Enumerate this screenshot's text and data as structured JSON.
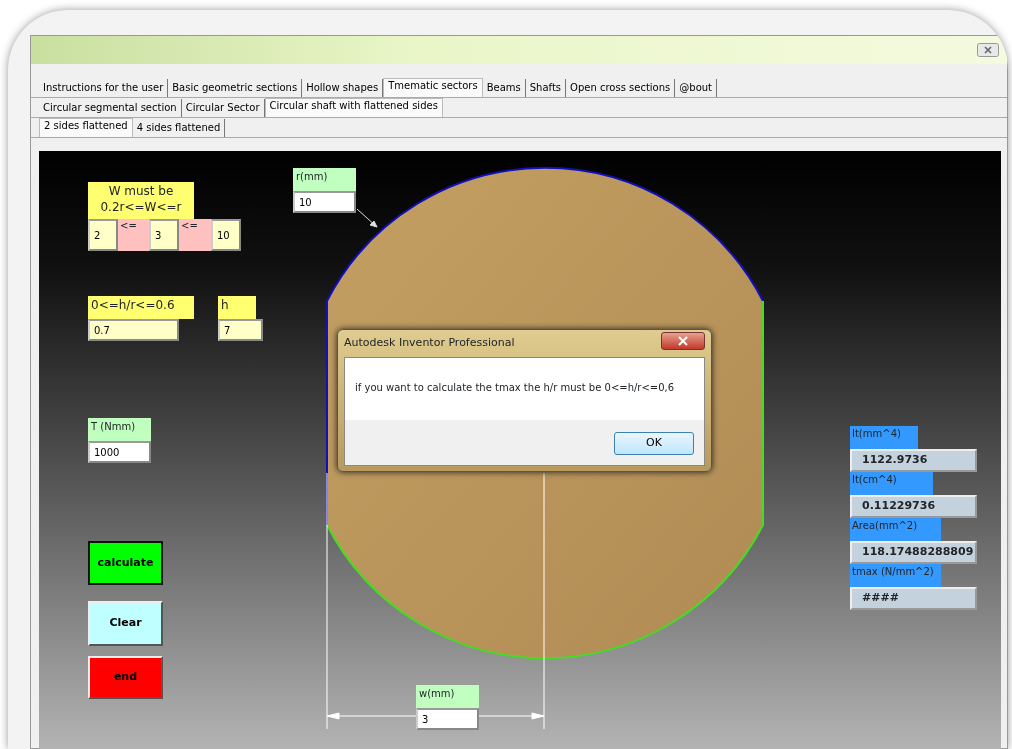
{
  "tab_rows": [
    [
      {
        "label": "Instructions for the user",
        "selected": false
      },
      {
        "label": "Basic geometric sections",
        "selected": false
      },
      {
        "label": "Hollow shapes",
        "selected": false
      },
      {
        "label": "Tmematic sectors",
        "selected": true
      },
      {
        "label": "Beams",
        "selected": false
      },
      {
        "label": "Shafts",
        "selected": false
      },
      {
        "label": "Open cross sections",
        "selected": false
      },
      {
        "label": "@bout",
        "selected": false
      }
    ],
    [
      {
        "label": "Circular segmental section",
        "selected": false
      },
      {
        "label": "Circular Sector",
        "selected": false
      },
      {
        "label": "Circular shaft with flattened sides",
        "selected": true
      }
    ],
    [
      {
        "label": "2 sides flattened",
        "selected": true
      },
      {
        "label": "4 sides flattened",
        "selected": false
      }
    ]
  ],
  "w_rule": {
    "label": "W must be 0.2r<=W<=r",
    "cells": [
      {
        "kind": "value",
        "text": "2"
      },
      {
        "kind": "operator",
        "text": "<="
      },
      {
        "kind": "value",
        "text": "3"
      },
      {
        "kind": "operator",
        "text": "<="
      },
      {
        "kind": "value",
        "text": "10"
      }
    ]
  },
  "inputs": [
    {
      "kind": "yellow",
      "label": "0<=h/r<=0.6",
      "value": "0.7"
    },
    {
      "kind": "yellow",
      "label": "h",
      "value": "7"
    },
    {
      "kind": "green",
      "label": "r(mm)",
      "value": "10"
    },
    {
      "kind": "green",
      "label": "T (Nmm)",
      "value": "1000"
    },
    {
      "kind": "green",
      "label": "w(mm)",
      "value": "3"
    }
  ],
  "buttons": [
    {
      "label": "calculate",
      "color": "#00ff00"
    },
    {
      "label": "Clear",
      "color": "#c0ffff"
    },
    {
      "label": "end",
      "color": "#ff0000"
    }
  ],
  "results": [
    {
      "label": "It(mm^4)",
      "value": "1122.9736"
    },
    {
      "label": "It(cm^4)",
      "value": "0.11229736"
    },
    {
      "label": "Area(mm^2)",
      "value": "118.17488288809"
    },
    {
      "label": "tmax (N/mm^2)",
      "value": "####"
    }
  ],
  "dialog": {
    "title": "Autodesk Inventor Professional",
    "message": "if you want to calculate the tmax the h/r must be 0<=h/r<=0,6",
    "button": "OK"
  }
}
